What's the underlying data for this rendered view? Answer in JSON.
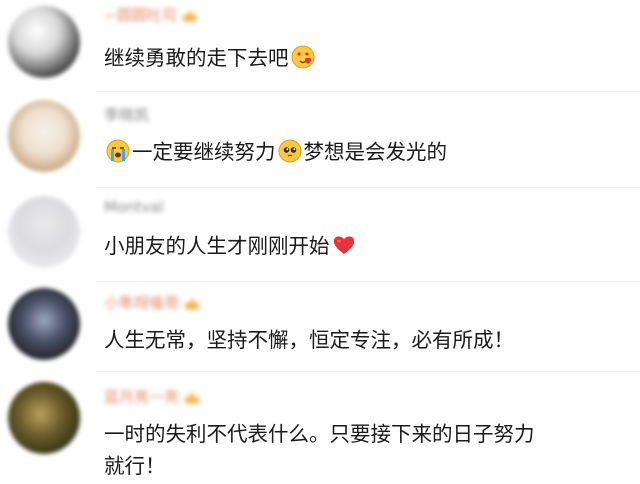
{
  "comments": [
    {
      "username": "~圆圆吐司",
      "text_before": "继续勇敢的走下去吧",
      "emoji_after": "heart-eyes-blowing-kiss-emoji",
      "badge": true
    },
    {
      "username": "李晓凯",
      "emoji_before": "loudly-crying-emoji",
      "text_before": "一定要继续努力",
      "emoji_mid": "pleading-face-emoji",
      "text_after": "梦想是会发光的",
      "badge": false
    },
    {
      "username": "Montval",
      "text_before": "小朋友的人生才刚刚开始",
      "emoji_after": "red-heart-emoji",
      "badge": false
    },
    {
      "username": "小隼呀嗑哥",
      "text_before": "人生无常，坚持不懈，恒定专注，必有所成！",
      "badge": true
    },
    {
      "username": "蓝月亮一亮",
      "text_line1": "一时的失利不代表什么。只要接下来的日子努力",
      "text_line2": "就行！",
      "badge": true
    }
  ],
  "colors": {
    "username_orange": "#e58a6a",
    "username_gray": "#8a8a8a",
    "text": "#1a1a1a",
    "badge": "#f0b24a",
    "heart": "#e8323a"
  }
}
